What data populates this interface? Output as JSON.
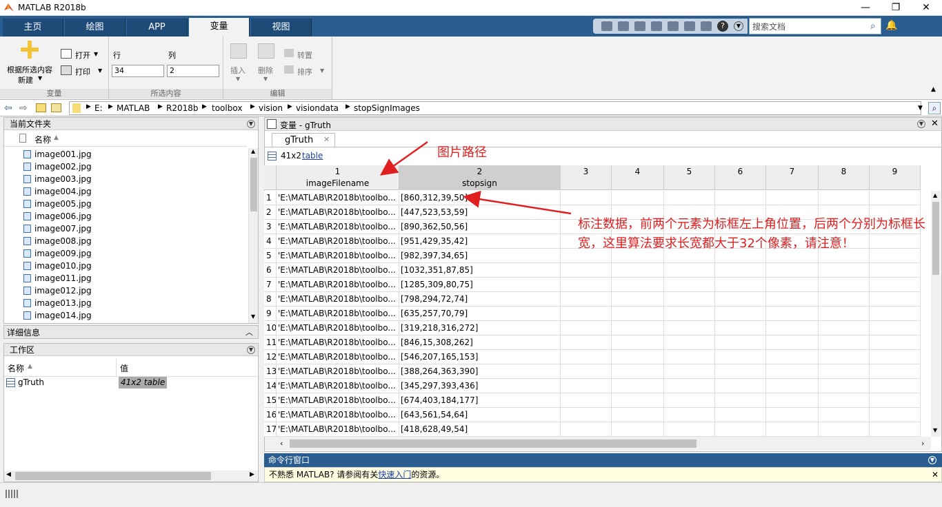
{
  "window": {
    "title": "MATLAB R2018b",
    "min": "—",
    "max": "❐",
    "close": "✕"
  },
  "tabs": [
    "主页",
    "绘图",
    "APP",
    "变量",
    "视图"
  ],
  "search": {
    "placeholder": "搜索文档"
  },
  "ribbon": {
    "new_from_selection": "根据所选内容",
    "new_label": "新建",
    "open": "打开",
    "print": "打印",
    "row_label": "行",
    "col_label": "列",
    "row_value": "34",
    "col_value": "2",
    "insert": "插入",
    "delete": "删除",
    "transpose": "转置",
    "sort": "排序",
    "group_variable": "变量",
    "group_selection": "所选内容",
    "group_edit": "编辑"
  },
  "address": {
    "path": [
      "E:",
      "MATLAB",
      "R2018b",
      "toolbox",
      "vision",
      "visiondata",
      "stopSignImages"
    ]
  },
  "current_folder": {
    "title": "当前文件夹",
    "column": "名称",
    "files": [
      "image001.jpg",
      "image002.jpg",
      "image003.jpg",
      "image004.jpg",
      "image005.jpg",
      "image006.jpg",
      "image007.jpg",
      "image008.jpg",
      "image009.jpg",
      "image010.jpg",
      "image011.jpg",
      "image012.jpg",
      "image013.jpg",
      "image014.jpg"
    ]
  },
  "details": {
    "title": "详细信息"
  },
  "workspace": {
    "title": "工作区",
    "col_name": "名称",
    "col_value": "值",
    "var_name": "gTruth",
    "var_value": "41x2 table"
  },
  "variable_editor": {
    "title": "变量 - gTruth",
    "tab": "gTruth",
    "size": "41x2",
    "type_link": "table",
    "columns": [
      {
        "num": "1",
        "name": "imageFilename"
      },
      {
        "num": "2",
        "name": "stopsign"
      },
      {
        "num": "3",
        "name": ""
      },
      {
        "num": "4",
        "name": ""
      },
      {
        "num": "5",
        "name": ""
      },
      {
        "num": "6",
        "name": ""
      },
      {
        "num": "7",
        "name": ""
      },
      {
        "num": "8",
        "name": ""
      },
      {
        "num": "9",
        "name": ""
      }
    ],
    "rows": [
      {
        "n": "1",
        "file": "'E:\\MATLAB\\R2018b\\toolbo...",
        "box": "[860,312,39,50]"
      },
      {
        "n": "2",
        "file": "'E:\\MATLAB\\R2018b\\toolbo...",
        "box": "[447,523,53,59]"
      },
      {
        "n": "3",
        "file": "'E:\\MATLAB\\R2018b\\toolbo...",
        "box": "[890,362,50,56]"
      },
      {
        "n": "4",
        "file": "'E:\\MATLAB\\R2018b\\toolbo...",
        "box": "[951,429,35,42]"
      },
      {
        "n": "5",
        "file": "'E:\\MATLAB\\R2018b\\toolbo...",
        "box": "[982,397,34,65]"
      },
      {
        "n": "6",
        "file": "'E:\\MATLAB\\R2018b\\toolbo...",
        "box": "[1032,351,87,85]"
      },
      {
        "n": "7",
        "file": "'E:\\MATLAB\\R2018b\\toolbo...",
        "box": "[1285,309,80,75]"
      },
      {
        "n": "8",
        "file": "'E:\\MATLAB\\R2018b\\toolbo...",
        "box": "[798,294,72,74]"
      },
      {
        "n": "9",
        "file": "'E:\\MATLAB\\R2018b\\toolbo...",
        "box": "[635,257,70,79]"
      },
      {
        "n": "10",
        "file": "'E:\\MATLAB\\R2018b\\toolbo...",
        "box": "[319,218,316,272]"
      },
      {
        "n": "11",
        "file": "'E:\\MATLAB\\R2018b\\toolbo...",
        "box": "[846,15,308,262]"
      },
      {
        "n": "12",
        "file": "'E:\\MATLAB\\R2018b\\toolbo...",
        "box": "[546,207,165,153]"
      },
      {
        "n": "13",
        "file": "'E:\\MATLAB\\R2018b\\toolbo...",
        "box": "[388,264,363,390]"
      },
      {
        "n": "14",
        "file": "'E:\\MATLAB\\R2018b\\toolbo...",
        "box": "[345,297,393,436]"
      },
      {
        "n": "15",
        "file": "'E:\\MATLAB\\R2018b\\toolbo...",
        "box": "[674,403,184,177]"
      },
      {
        "n": "16",
        "file": "'E:\\MATLAB\\R2018b\\toolbo...",
        "box": "[643,561,54,64]"
      },
      {
        "n": "17",
        "file": "'E:\\MATLAB\\R2018b\\toolbo...",
        "box": "[418,628,49,54]"
      }
    ]
  },
  "annotations": {
    "path_note": "图片路径",
    "box_note": "标注数据，前两个元素为标框左上角位置，后两个分别为标框长宽，这里算法要求长宽都大于32个像素，请注意！",
    "color": "#e02020"
  },
  "command_window": {
    "title": "命令行窗口",
    "msg_pre": "不熟悉 MATLAB? 请参阅有关",
    "msg_link": "快速入门",
    "msg_post": "的资源。"
  }
}
